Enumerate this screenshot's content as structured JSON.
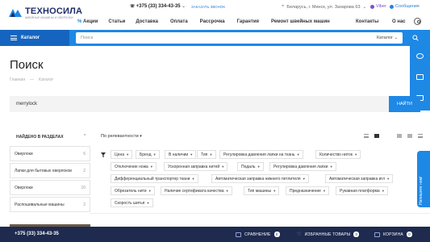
{
  "header": {
    "logo_name": "ТЕХНОСИЛА",
    "logo_sub": "ШВЕЙНЫЕ МАШИНЫ И ОВЕРЛОКИ",
    "phone": "+375 (33) 334-43-35",
    "callback": "ЗАКАЗАТЬ ЗВОНОК",
    "address": "Беларусь, г. Минск, ул. Захарова 63",
    "viber": "Viber",
    "messages": "Сообщение",
    "nav": [
      "Акции",
      "Статьи",
      "Доставка",
      "Оплата",
      "Рассрочка",
      "Гарантия",
      "Ремонт швейных машин"
    ],
    "contacts": "Контакты",
    "about": "О нас"
  },
  "search": {
    "catalog_label": "Каталог",
    "placeholder": "Поиск",
    "scope": "Каталог"
  },
  "page": {
    "title": "Поиск",
    "breadcrumbs": [
      "Главная",
      "—",
      "Каталог"
    ],
    "query": "merrylock",
    "find_label": "НАЙТИ"
  },
  "sections": {
    "heading": "НАЙДЕНО В РАЗДЕЛАХ",
    "items": [
      {
        "label": "Оверлоки",
        "count": "6"
      },
      {
        "label": "Лапки для бытовых оверлоков",
        "count": "2"
      },
      {
        "label": "Оверлоки",
        "count": "10"
      },
      {
        "label": "Распошивальные машины",
        "count": "2"
      }
    ]
  },
  "sort": {
    "label": "По релевантности"
  },
  "filters": [
    "Цена",
    "Бренд",
    "В наличии",
    "Тип",
    "Регулировка давления лапки на ткань",
    "Количество ниток",
    "Отключение ножа",
    "Ускоренная заправка нитей",
    "Педаль",
    "Регулировка давления лапки",
    "Дифференциальный транспортер ткани",
    "Автоматическая заправка нижнего петлителя",
    "Автоматическая заправка игл",
    "Обрезатель нити",
    "Наличие сертификата качества",
    "Тип машины",
    "Предназначение",
    "Рукавная платформа",
    "Скорость шитья"
  ],
  "side_tab": {
    "feedback": "Напишите нам!"
  },
  "bottom_bar": {
    "phone": "+375 (33) 334-43-35",
    "compare_label": "СРАВНЕНИЕ",
    "compare_count": "0",
    "favorites_label": "ИЗБРАННЫЕ ТОВАРЫ",
    "favorites_count": "0",
    "cart_label": "КОРЗИНА",
    "cart_count": "0"
  },
  "colors": {
    "accent": "#1e88e5",
    "accent_dark": "#1565c0",
    "bottom_bar": "#1e2a4e",
    "viber": "#7d50c6"
  }
}
